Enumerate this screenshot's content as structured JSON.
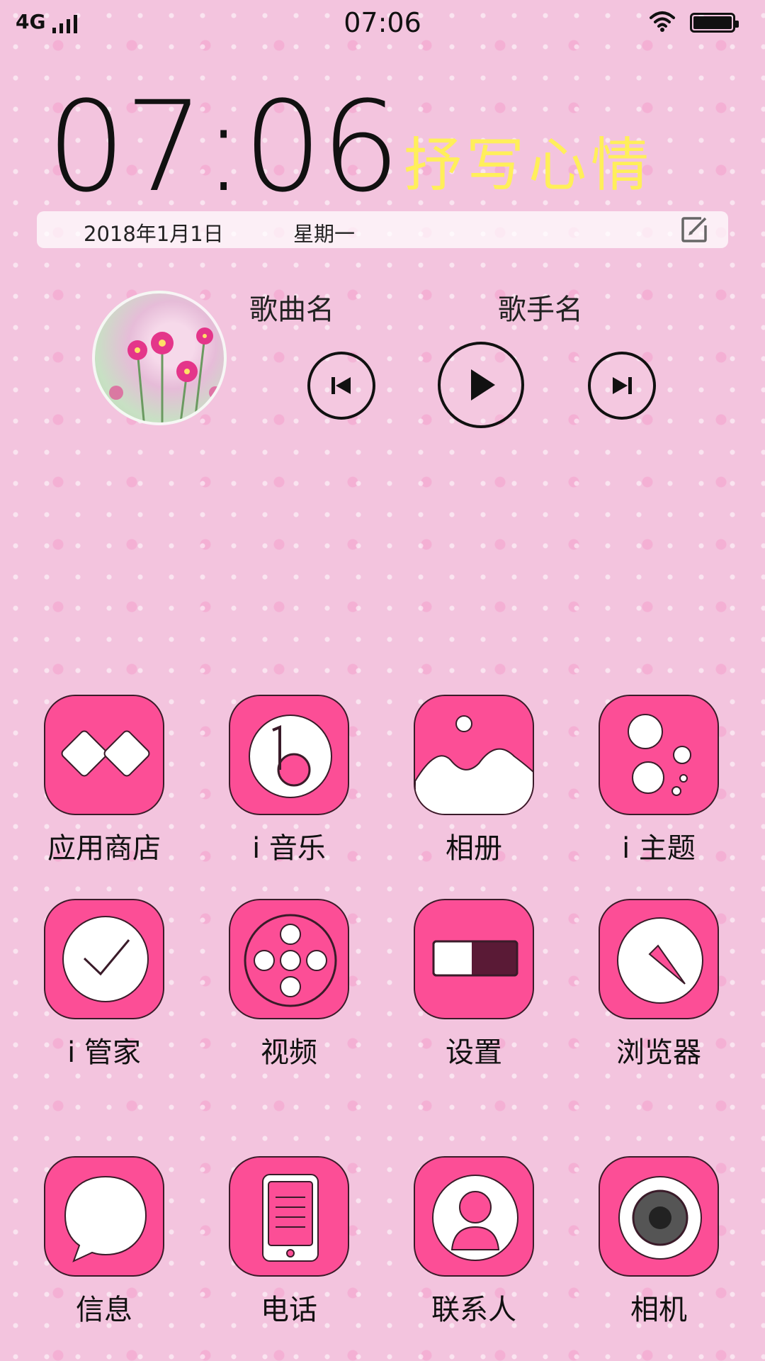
{
  "status_bar": {
    "network": "4G",
    "time": "07:06"
  },
  "clock_widget": {
    "time": "07:06",
    "mood_text": "抒写心情",
    "date": "2018年1月1日",
    "weekday": "星期一"
  },
  "music_widget": {
    "song_name": "歌曲名",
    "artist_name": "歌手名"
  },
  "apps_row1": [
    {
      "label": "应用商店",
      "icon": "app-store-icon"
    },
    {
      "label": "i 音乐",
      "icon": "music-icon"
    },
    {
      "label": "相册",
      "icon": "gallery-icon"
    },
    {
      "label": "i 主题",
      "icon": "theme-icon"
    }
  ],
  "apps_row2": [
    {
      "label": "i 管家",
      "icon": "manager-icon"
    },
    {
      "label": "视频",
      "icon": "video-icon"
    },
    {
      "label": "设置",
      "icon": "settings-icon"
    },
    {
      "label": "浏览器",
      "icon": "browser-icon"
    }
  ],
  "dock": [
    {
      "label": "信息",
      "icon": "messages-icon"
    },
    {
      "label": "电话",
      "icon": "phone-icon"
    },
    {
      "label": "联系人",
      "icon": "contacts-icon"
    },
    {
      "label": "相机",
      "icon": "camera-icon"
    }
  ],
  "colors": {
    "accent": "#fc4e96",
    "background": "#f3c4de",
    "mood_text": "#ffef5a"
  }
}
